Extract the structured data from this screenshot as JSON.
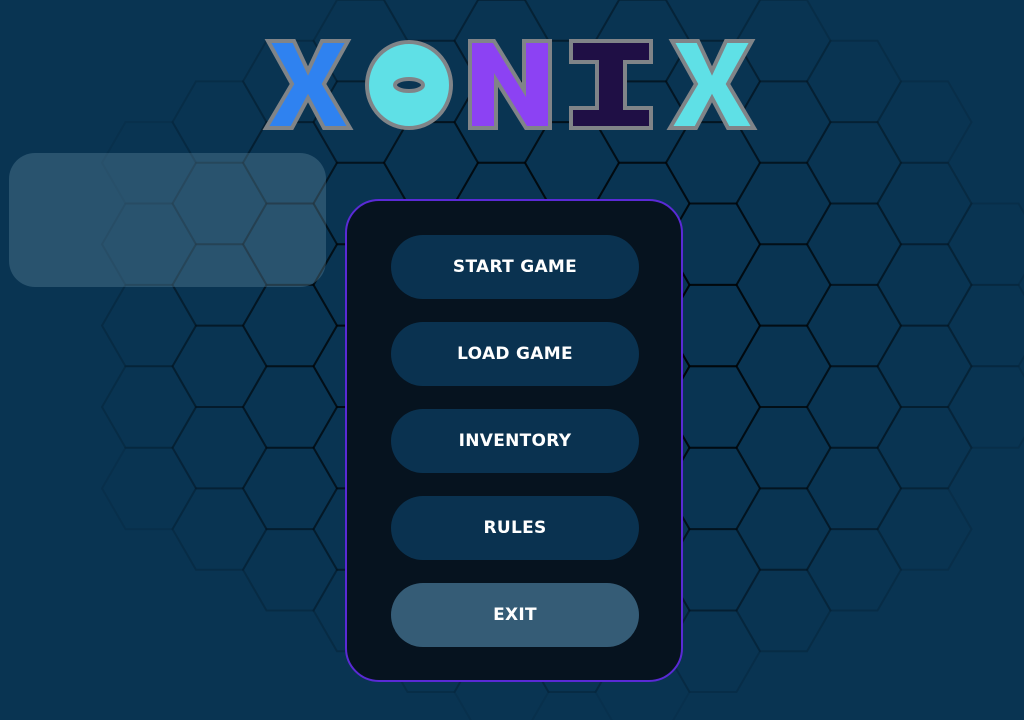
{
  "title": {
    "letters": [
      {
        "char": "X",
        "color": "#2f82f0"
      },
      {
        "char": "O",
        "color": "#5fe0e6"
      },
      {
        "char": "N",
        "color": "#8c42f3"
      },
      {
        "char": "I",
        "color": "#1f0f45"
      },
      {
        "char": "X",
        "color": "#5fe0e6"
      }
    ],
    "outline_color": "#808488"
  },
  "menu": {
    "buttons": [
      {
        "label": "START GAME",
        "name": "start-game-button"
      },
      {
        "label": "LOAD GAME",
        "name": "load-game-button"
      },
      {
        "label": "INVENTORY",
        "name": "inventory-button"
      },
      {
        "label": "RULES",
        "name": "rules-button"
      },
      {
        "label": "EXIT",
        "name": "exit-button"
      }
    ]
  },
  "colors": {
    "background": "#093452",
    "menu_panel": "#06131f",
    "menu_border": "#5a2ad6",
    "button": "#0a3250",
    "exit_button": "#355c76",
    "info_panel": "rgba(110,150,170,0.32)"
  }
}
